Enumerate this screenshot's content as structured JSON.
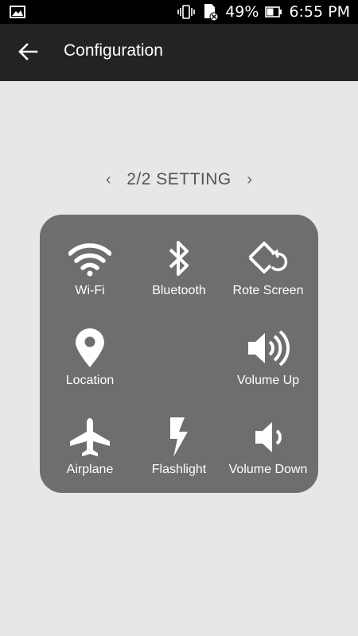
{
  "status_bar": {
    "battery_percent": "49%",
    "time": "6:55 PM"
  },
  "app_bar": {
    "title": "Configuration"
  },
  "pager": {
    "label": "2/2 SETTING"
  },
  "grid": {
    "items": [
      {
        "label": "Wi-Fi",
        "icon": "wifi-icon"
      },
      {
        "label": "Bluetooth",
        "icon": "bluetooth-icon"
      },
      {
        "label": "Rote Screen",
        "icon": "rotate-screen-icon"
      },
      {
        "label": "Location",
        "icon": "location-pin-icon"
      },
      {
        "label": "",
        "icon": ""
      },
      {
        "label": "Volume Up",
        "icon": "volume-up-icon"
      },
      {
        "label": "Airplane",
        "icon": "airplane-icon"
      },
      {
        "label": "Flashlight",
        "icon": "flashlight-icon"
      },
      {
        "label": "Volume Down",
        "icon": "volume-down-icon"
      }
    ]
  },
  "colors": {
    "status_bar": "#000000",
    "app_bar": "#232323",
    "background": "#e8e6e9",
    "panel": "#6e6d6f"
  }
}
